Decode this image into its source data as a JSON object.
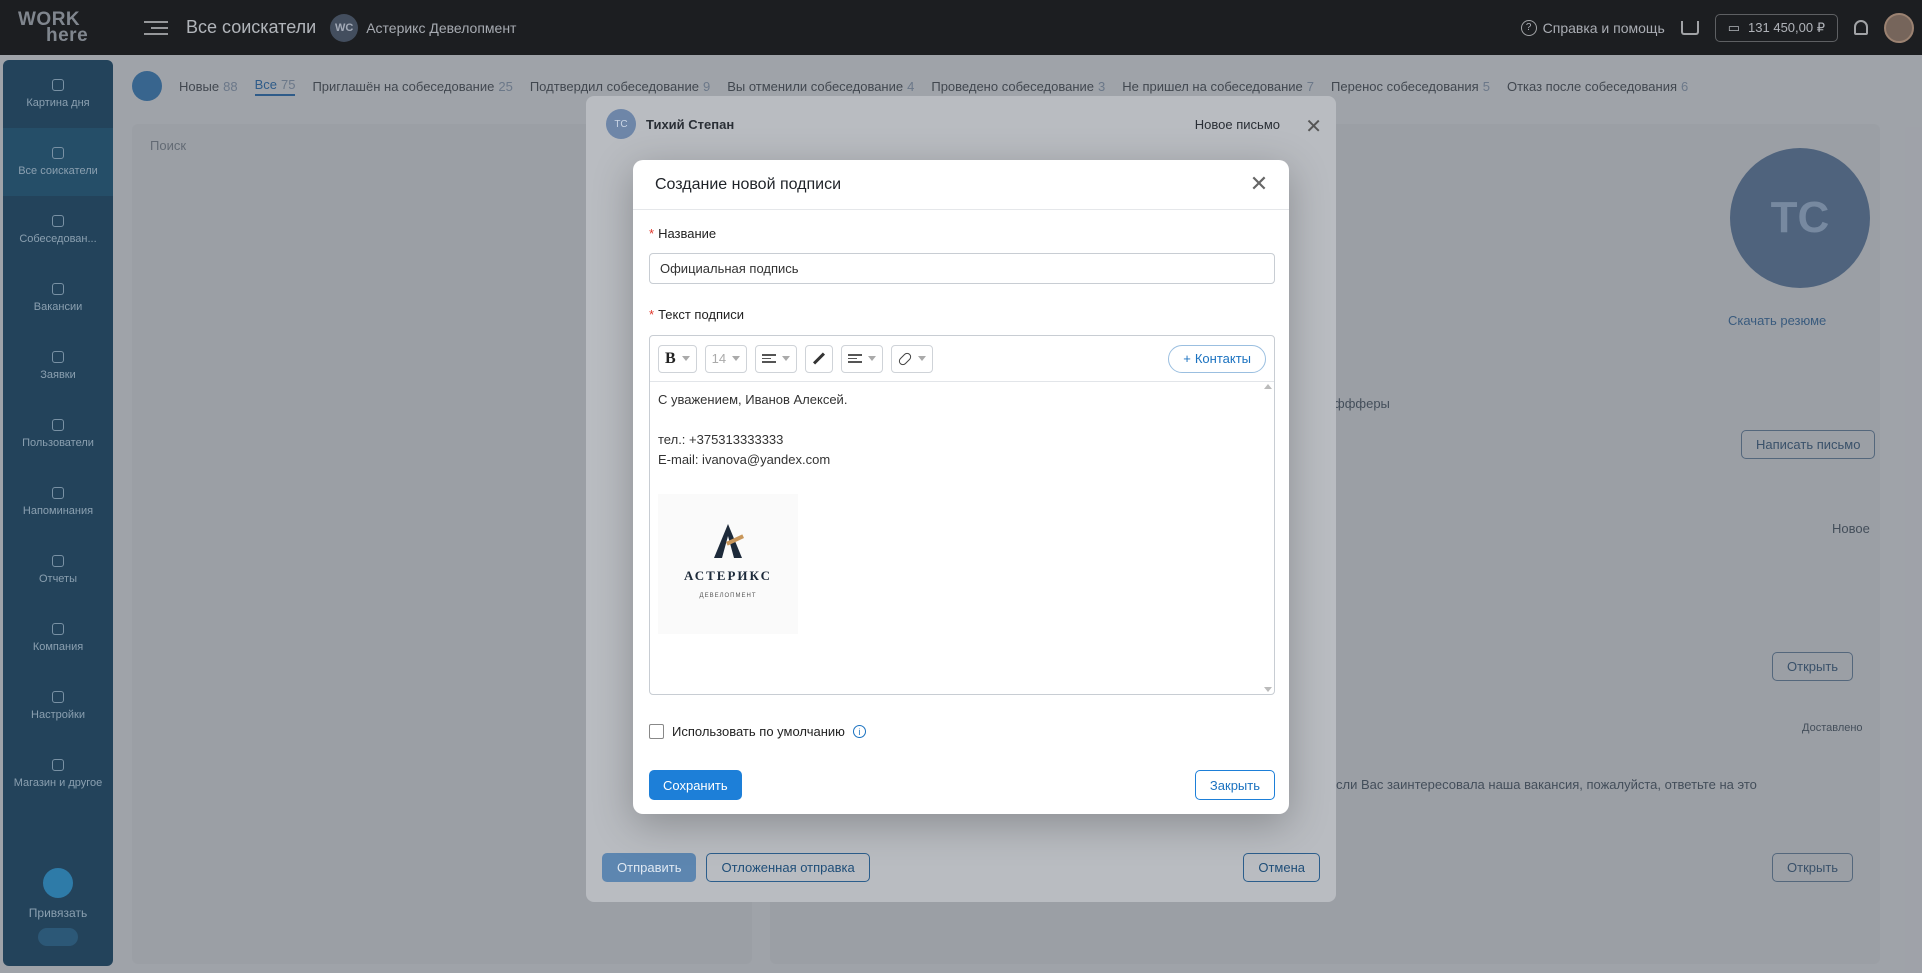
{
  "app": {
    "logo_line1": "WORK",
    "logo_line2": "here",
    "page_title": "Все соискатели",
    "company_badge": "WC",
    "company_name": "Астерикс Девелопмент",
    "help_label": "Справка и помощь",
    "balance": "131 450,00 ₽"
  },
  "sidebar": {
    "items": [
      {
        "label": "Картина дня",
        "icon": "rocket-icon"
      },
      {
        "label": "Все соискатели",
        "icon": "users-icon"
      },
      {
        "label": "Собеседован...",
        "icon": "calendar-icon"
      },
      {
        "label": "Вакансии",
        "icon": "calendar-icon"
      },
      {
        "label": "Заявки",
        "icon": "list-icon"
      },
      {
        "label": "Пользователи",
        "icon": "user-icon"
      },
      {
        "label": "Напоминания",
        "icon": "clock-icon"
      },
      {
        "label": "Отчеты",
        "icon": "chart-icon"
      },
      {
        "label": "Компания",
        "icon": "home-icon"
      },
      {
        "label": "Настройки",
        "icon": "gear-icon"
      },
      {
        "label": "Магазин и другое",
        "icon": "cart-icon"
      }
    ],
    "bottom_label": "Привязать"
  },
  "tabs": [
    {
      "label": "Новые",
      "count": "88"
    },
    {
      "label": "Все",
      "count": "75"
    },
    {
      "label": "Приглашён на собеседование",
      "count": "25"
    },
    {
      "label": "Подтвердил собеседование",
      "count": "9"
    },
    {
      "label": "Вы отменили собеседование",
      "count": "4"
    },
    {
      "label": "Проведено собеседование",
      "count": "3"
    },
    {
      "label": "Не пришел на собеседование",
      "count": "7"
    },
    {
      "label": "Перенос собеседования",
      "count": "5"
    },
    {
      "label": "Отказ после собеседования",
      "count": "6"
    }
  ],
  "background": {
    "search_placeholder": "Поиск",
    "avatar_initials": "ТС",
    "download_resume": "Скачать резюме",
    "write_letter": "Написать письмо",
    "open_label": "Открыть",
    "new_label": "Новое",
    "delivered_label": "Доставлено",
    "offers_label": "ффферы",
    "message_snippet": "сли Вас заинтересовала наша вакансия, пожалуйста, ответьте на это"
  },
  "mail_modal": {
    "avatar_initials": "ТС",
    "recipient": "Тихий Степан",
    "type": "Новое письмо",
    "send_label": "Отправить",
    "delayed_label": "Отложенная отправка",
    "cancel_label": "Отмена"
  },
  "signature_dialog": {
    "title": "Создание новой подписи",
    "name_label": "Название",
    "name_value": "Официальная подпись",
    "text_label": "Текст подписи",
    "font_size": "14",
    "contacts_label": "Контакты",
    "content_lines": [
      "С уважением, Иванов Алексей.",
      "",
      "тел.: +375313333333",
      "E-mail: ivanova@yandex.com"
    ],
    "logo_word": "АСТЕРИКС",
    "logo_sub": "ДЕВЕЛОПМЕНТ",
    "default_label": "Использовать по умолчанию",
    "save_label": "Сохранить",
    "close_label": "Закрыть"
  }
}
